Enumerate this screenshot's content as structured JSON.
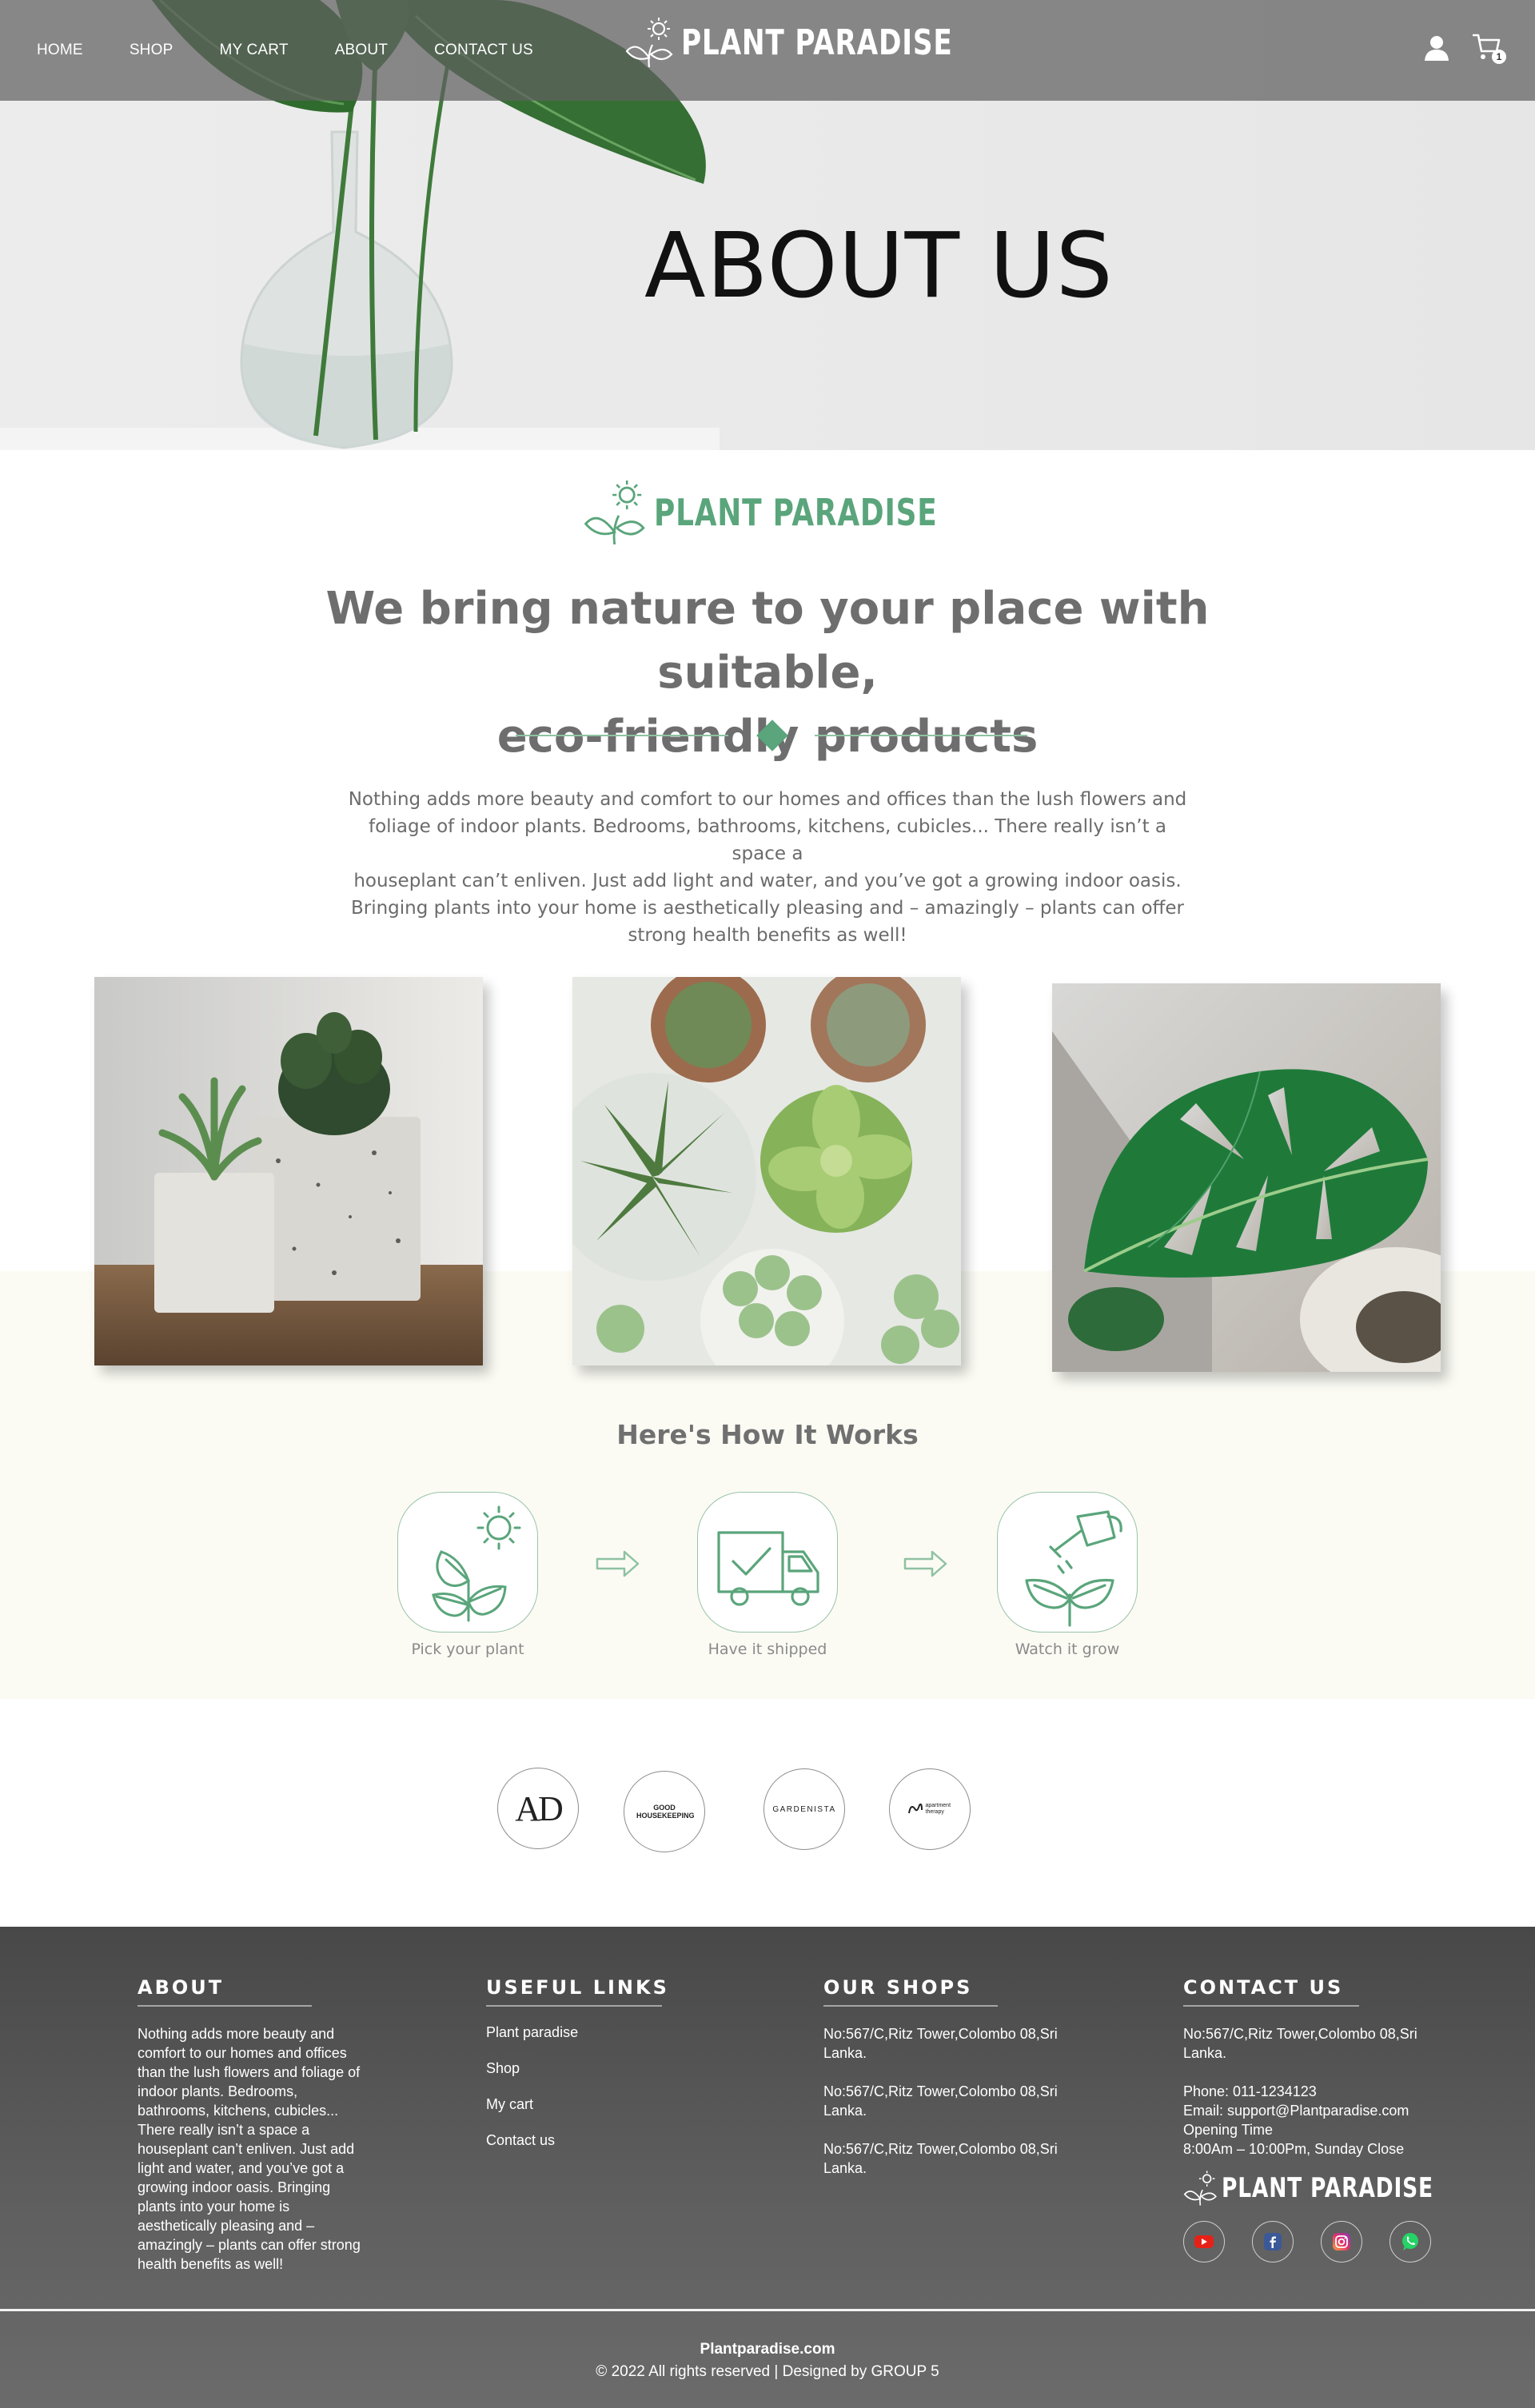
{
  "header": {
    "nav": [
      "HOME",
      "SHOP",
      "MY CART",
      "ABOUT",
      "CONTACT US"
    ],
    "brand": "PLANT PARADISE",
    "cart_count": "1",
    "icons": [
      "user-icon",
      "cart-icon"
    ]
  },
  "hero": {
    "title": "ABOUT US"
  },
  "intro": {
    "brand": "PLANT PARADISE",
    "tagline_line1": "We bring nature to your place with suitable,",
    "tagline_line2": "eco-friendly products",
    "text_line1": "Nothing adds more beauty and comfort to our homes and offices than the lush flowers and",
    "text_line2": "foliage of indoor plants. Bedrooms, bathrooms, kitchens, cubicles... There really isn’t a space a",
    "text_line3": "houseplant can’t enliven. Just add light and water, and you’ve got a growing indoor oasis.",
    "text_line4": "Bringing plants into your home is aesthetically pleasing and – amazingly – plants can offer",
    "text_line5": "strong health benefits as well!"
  },
  "how_it_works": {
    "title": "Here's How It Works",
    "steps": [
      {
        "label": "Pick your plant",
        "icon": "plant-sun-icon"
      },
      {
        "label": "Have it shipped",
        "icon": "delivery-truck-icon"
      },
      {
        "label": "Watch it grow",
        "icon": "watering-can-icon"
      }
    ]
  },
  "partners": [
    "AD",
    "GOOD HOUSEKEEPING",
    "GARDENISTA",
    "apartment therapy"
  ],
  "footer": {
    "about": {
      "heading": "ABOUT",
      "lines": [
        "Nothing adds more beauty and",
        "comfort to our homes and offices",
        "than the lush flowers and foliage of",
        "indoor plants. Bedrooms,",
        "bathrooms, kitchens, cubicles...",
        "There really isn’t a space a",
        "houseplant can’t enliven. Just add",
        "light and water, and you’ve got a",
        "growing indoor oasis. Bringing",
        "plants into your home is",
        "aesthetically pleasing and –",
        "amazingly – plants can offer strong",
        "health benefits as well!"
      ]
    },
    "links": {
      "heading": "USEFUL LINKS",
      "items": [
        "Plant paradise",
        "Shop",
        "My cart",
        "Contact us"
      ]
    },
    "shops": {
      "heading": "OUR SHOPS",
      "items": [
        [
          "No:567/C,Ritz Tower,Colombo 08,Sri",
          "Lanka."
        ],
        [
          "No:567/C,Ritz Tower,Colombo 08,Sri",
          "Lanka."
        ],
        [
          "No:567/C,Ritz Tower,Colombo 08,Sri",
          "Lanka."
        ]
      ]
    },
    "contact": {
      "heading": "CONTACT US",
      "address1": "No:567/C,Ritz Tower,Colombo 08,Sri",
      "address2": "Lanka.",
      "phone": "Phone: 011-1234123",
      "email": "Email: support@Plantparadise.com",
      "hours_label": "Opening Time",
      "hours": "8:00Am – 10:00Pm, Sunday Close",
      "brand": "PLANT PARADISE",
      "social": [
        "youtube-icon",
        "facebook-icon",
        "instagram-icon",
        "whatsapp-icon"
      ]
    },
    "site": "Plantparadise.com",
    "copyright": "© 2022 All rights reserved | Designed by GROUP 5"
  },
  "colors": {
    "accent": "#5aa57b",
    "footer_bg": "#4e4e4e",
    "cream": "#fbfbf4"
  }
}
